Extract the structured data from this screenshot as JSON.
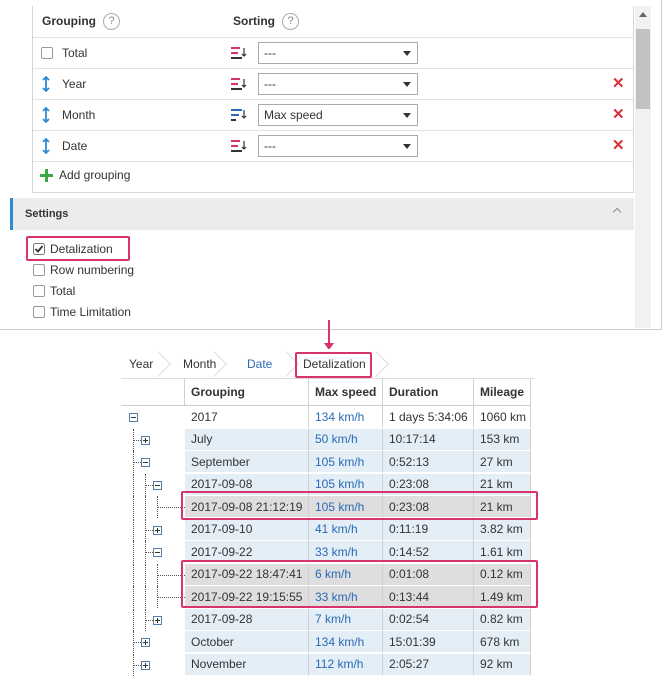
{
  "grouping": {
    "header_grouping": "Grouping",
    "header_sorting": "Sorting",
    "help_glyph": "?",
    "rows": [
      {
        "label": "Total",
        "sort": "---",
        "icon": "checkbox",
        "sort_icon": "sort-desc-icon",
        "deletable": false
      },
      {
        "label": "Year",
        "sort": "---",
        "icon": "vertical-arrows-icon",
        "sort_icon": "sort-desc-icon",
        "deletable": true
      },
      {
        "label": "Month",
        "sort": "Max speed",
        "icon": "vertical-arrows-icon",
        "sort_icon": "sort-asc-icon",
        "deletable": true
      },
      {
        "label": "Date",
        "sort": "---",
        "icon": "vertical-arrows-icon",
        "sort_icon": "sort-desc-icon",
        "deletable": true
      }
    ],
    "add_label": "Add grouping",
    "delete_glyph": "✕"
  },
  "settings": {
    "title": "Settings",
    "options": [
      {
        "label": "Detalization",
        "checked": true
      },
      {
        "label": "Row numbering",
        "checked": false
      },
      {
        "label": "Total",
        "checked": false
      },
      {
        "label": "Time Limitation",
        "checked": false
      }
    ]
  },
  "breadcrumb": [
    "Year",
    "Month",
    "Date",
    "Detalization"
  ],
  "table": {
    "columns": [
      "Grouping",
      "Max speed",
      "Duration",
      "Mileage"
    ],
    "rows": [
      {
        "g": "2017",
        "s": "134 km/h",
        "d": "1 days 5:34:06",
        "m": "1060 km",
        "level": 0,
        "toggle": "minus",
        "style": "plain"
      },
      {
        "g": "July",
        "s": "50 km/h",
        "d": "10:17:14",
        "m": "153 km",
        "level": 1,
        "toggle": "plus",
        "style": "alt"
      },
      {
        "g": "September",
        "s": "105 km/h",
        "d": "0:52:13",
        "m": "27 km",
        "level": 1,
        "toggle": "minus",
        "style": "alt"
      },
      {
        "g": "2017-09-08",
        "s": "105 km/h",
        "d": "0:23:08",
        "m": "21 km",
        "level": 2,
        "toggle": "minus",
        "style": "alt"
      },
      {
        "g": "2017-09-08 21:12:19",
        "s": "105 km/h",
        "d": "0:23:08",
        "m": "21 km",
        "level": 3,
        "toggle": "leaf",
        "style": "alt2"
      },
      {
        "g": "2017-09-10",
        "s": "41 km/h",
        "d": "0:11:19",
        "m": "3.82 km",
        "level": 2,
        "toggle": "plus",
        "style": "alt"
      },
      {
        "g": "2017-09-22",
        "s": "33 km/h",
        "d": "0:14:52",
        "m": "1.61 km",
        "level": 2,
        "toggle": "minus",
        "style": "alt"
      },
      {
        "g": "2017-09-22 18:47:41",
        "s": "6 km/h",
        "d": "0:01:08",
        "m": "0.12 km",
        "level": 3,
        "toggle": "leaf",
        "style": "alt2"
      },
      {
        "g": "2017-09-22 19:15:55",
        "s": "33 km/h",
        "d": "0:13:44",
        "m": "1.49 km",
        "level": 3,
        "toggle": "leaf",
        "style": "alt2"
      },
      {
        "g": "2017-09-28",
        "s": "7 km/h",
        "d": "0:02:54",
        "m": "0.82 km",
        "level": 2,
        "toggle": "plus",
        "style": "alt"
      },
      {
        "g": "October",
        "s": "134 km/h",
        "d": "15:01:39",
        "m": "678 km",
        "level": 1,
        "toggle": "plus",
        "style": "alt"
      },
      {
        "g": "November",
        "s": "112 km/h",
        "d": "2:05:27",
        "m": "92 km",
        "level": 1,
        "toggle": "plus",
        "style": "alt"
      }
    ]
  },
  "colors": {
    "accent": "#2d8bd5",
    "highlight": "#d9336b",
    "delete": "#d9303a",
    "link": "#2a6ab5",
    "add": "#3aa845"
  }
}
